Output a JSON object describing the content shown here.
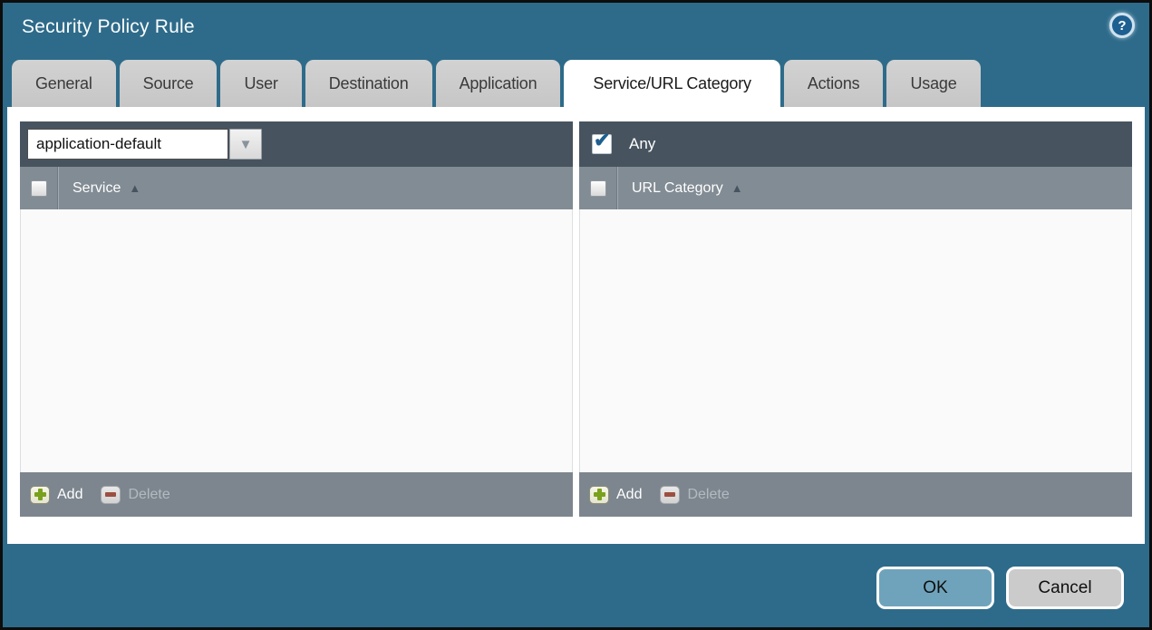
{
  "dialog": {
    "title": "Security Policy Rule"
  },
  "icons": {
    "help": "?",
    "dropdown_arrow": "▼",
    "sort_asc": "▲",
    "check": "✔"
  },
  "tabs": [
    {
      "label": "General",
      "active": false
    },
    {
      "label": "Source",
      "active": false
    },
    {
      "label": "User",
      "active": false
    },
    {
      "label": "Destination",
      "active": false
    },
    {
      "label": "Application",
      "active": false
    },
    {
      "label": "Service/URL Category",
      "active": true
    },
    {
      "label": "Actions",
      "active": false
    },
    {
      "label": "Usage",
      "active": false
    }
  ],
  "service_panel": {
    "dropdown": {
      "value": "application-default"
    },
    "header": {
      "label": "Service",
      "checkbox_checked": false,
      "sort": "ascending"
    },
    "rows": [],
    "footer": {
      "add_label": "Add",
      "delete_label": "Delete",
      "delete_enabled": false
    }
  },
  "url_category_panel": {
    "any": {
      "label": "Any",
      "checked": true
    },
    "header": {
      "label": "URL Category",
      "checkbox_checked": false,
      "sort": "ascending"
    },
    "rows": [],
    "footer": {
      "add_label": "Add",
      "delete_label": "Delete",
      "delete_enabled": false
    }
  },
  "actions": {
    "ok_label": "OK",
    "cancel_label": "Cancel"
  },
  "colors": {
    "dialog_teal": "#2e6b8a",
    "panel_dark": "#47545f",
    "header_gray": "#828c94",
    "footer_gray": "#7d868e",
    "tab_inactive": "#cbcbcb",
    "tab_active": "#ffffff",
    "ok_button": "#6fa3bb",
    "cancel_button": "#cbcbcb",
    "add_green": "#7aa11d",
    "delete_red": "#9c4f41",
    "check_blue": "#1d5f8f"
  }
}
